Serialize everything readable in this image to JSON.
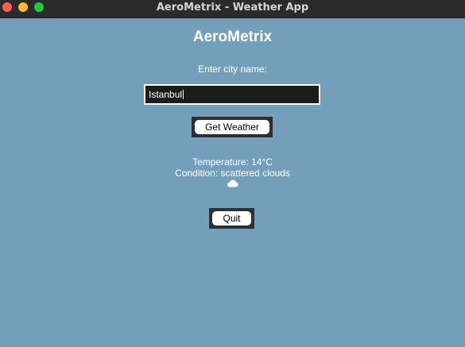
{
  "window": {
    "title": "AeroMetrix - Weather App"
  },
  "app": {
    "title": "AeroMetrix"
  },
  "form": {
    "prompt": "Enter city name:",
    "city_value": "Istanbul",
    "get_weather_label": "Get Weather",
    "quit_label": "Quit"
  },
  "result": {
    "temperature": "Temperature: 14°C",
    "condition": "Condition: scattered clouds",
    "icon": "cloud-icon"
  },
  "colors": {
    "background": "#749fbb",
    "titlebar": "#2b2b2b",
    "input_bg": "#1c1c1c",
    "button_frame": "#2f2f2f"
  }
}
